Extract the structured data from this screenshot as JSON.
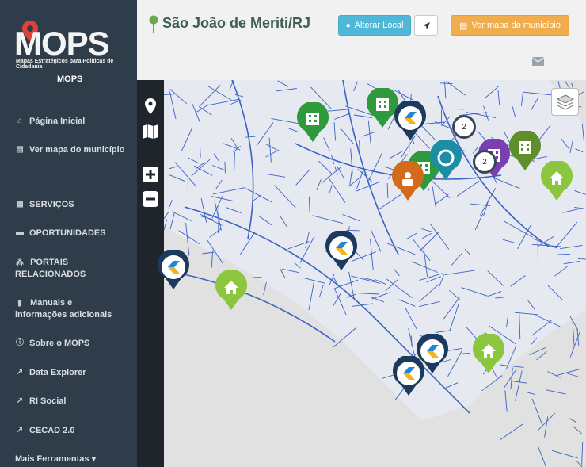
{
  "logo": {
    "word": "MOPS",
    "tagline": "Mapas Estratégicos para Políticas de Cidadania",
    "subtitle": "MOPS"
  },
  "sidebar": {
    "items": [
      {
        "label": "Página Inicial",
        "icon": "home-icon"
      },
      {
        "label": "Ver mapa do município",
        "icon": "map-icon"
      },
      {
        "label": "SERVIÇOS",
        "icon": "grid-icon"
      },
      {
        "label": "OPORTUNIDADES",
        "icon": "briefcase-icon"
      },
      {
        "label": "PORTAIS RELACIONADOS",
        "icon": "sitemap-icon"
      },
      {
        "label": "Manuais e informações adicionais",
        "icon": "book-icon"
      },
      {
        "label": "Sobre o MOPS",
        "icon": "info-icon"
      },
      {
        "label": "Data Explorer",
        "icon": "external-link-icon"
      },
      {
        "label": "RI Social",
        "icon": "external-link-icon"
      },
      {
        "label": "CECAD 2.0",
        "icon": "external-link-icon"
      },
      {
        "label": "Mais Ferramentas ▾",
        "icon": ""
      }
    ]
  },
  "header": {
    "city": "São João de Meriti/RJ",
    "alterar_label": "Alterar Local",
    "ver_mapa_label": "Ver mapa do município"
  },
  "map": {
    "clusters": [
      "2",
      "2"
    ]
  },
  "colors": {
    "sidebar_bg": "#2f3c4a",
    "accent_blue": "#4fb8d8",
    "accent_orange": "#f0ad4e",
    "city_pin": "#6aa84f",
    "marker_green": "#2e9a3d",
    "marker_lime": "#8cc63f",
    "marker_navy": "#1c3a5e",
    "marker_orange": "#d46a1c",
    "marker_purple": "#7a3fb0",
    "marker_olive": "#5f8f2a",
    "marker_teal": "#1b8ea3"
  }
}
